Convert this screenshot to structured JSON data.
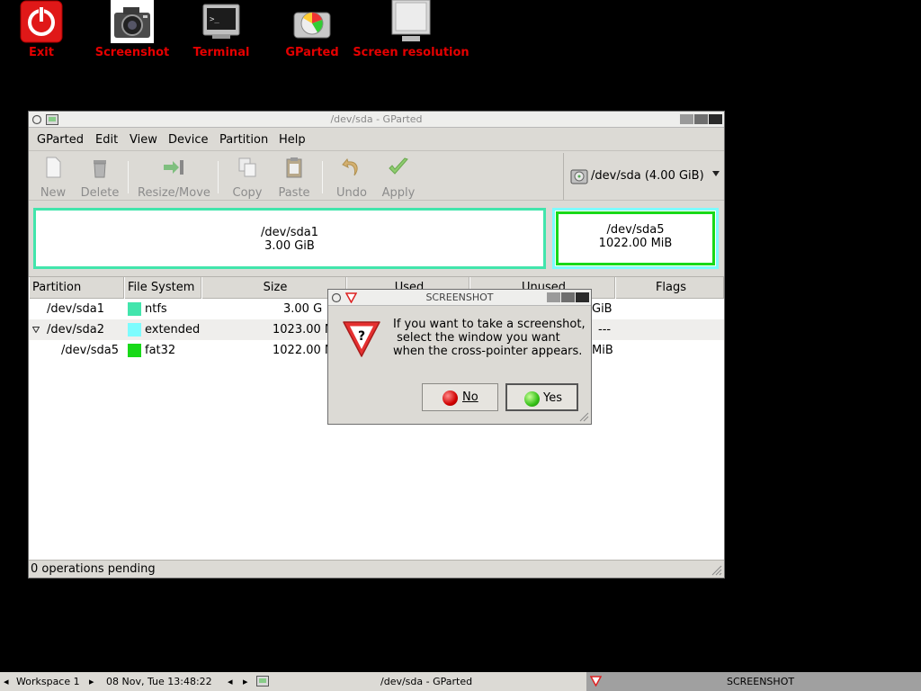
{
  "desktop": {
    "icons": [
      {
        "label": "Exit",
        "icon": "power-icon"
      },
      {
        "label": "Screenshot",
        "icon": "camera-icon"
      },
      {
        "label": "Terminal",
        "icon": "terminal-icon"
      },
      {
        "label": "GParted",
        "icon": "gparted-icon"
      },
      {
        "label": "Screen resolution",
        "icon": "monitor-icon"
      }
    ]
  },
  "window": {
    "title": "/dev/sda - GParted",
    "menu": [
      "GParted",
      "Edit",
      "View",
      "Device",
      "Partition",
      "Help"
    ],
    "toolbar": {
      "new": "New",
      "delete": "Delete",
      "resize_move": "Resize/Move",
      "copy": "Copy",
      "paste": "Paste",
      "undo": "Undo",
      "apply": "Apply"
    },
    "device": "/dev/sda  (4.00 GiB)",
    "graphic": [
      {
        "name": "/dev/sda1",
        "size": "3.00 GiB"
      },
      {
        "name": "/dev/sda5",
        "size": "1022.00 MiB"
      }
    ],
    "columns": [
      "Partition",
      "File System",
      "Size",
      "Used",
      "Unused",
      "Flags"
    ],
    "rows": [
      {
        "partition": "/dev/sda1",
        "fs": "ntfs",
        "size": "3.00 G",
        "unused": "GiB",
        "fs_color": "#42e5ac"
      },
      {
        "partition": "/dev/sda2",
        "fs": "extended",
        "size": "1023.00 M",
        "unused": "---",
        "fs_color": "#7dfcfe"
      },
      {
        "partition": "/dev/sda5",
        "fs": "fat32",
        "size": "1022.00 M",
        "unused": "MiB",
        "fs_color": "#18d918"
      }
    ],
    "status": "0 operations pending"
  },
  "dialog": {
    "title": "SCREENSHOT",
    "message": "If you want to take a screenshot,\n select the window you want\nwhen the cross-pointer appears.",
    "no": "No",
    "yes": "Yes"
  },
  "taskbar": {
    "workspace": "Workspace 1",
    "clock": "08 Nov, Tue 13:48:22",
    "task1": "/dev/sda - GParted",
    "task2": "SCREENSHOT"
  }
}
